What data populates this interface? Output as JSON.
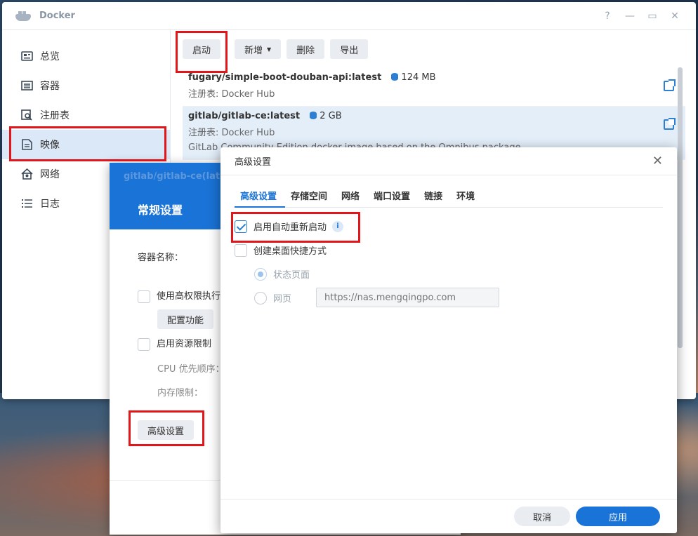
{
  "window": {
    "title": "Docker",
    "controls": {
      "help": "?",
      "minimize": "—",
      "maximize": "▭",
      "close": "✕"
    }
  },
  "sidebar": {
    "items": [
      {
        "label": "总览",
        "icon": "overview-icon"
      },
      {
        "label": "容器",
        "icon": "container-icon"
      },
      {
        "label": "注册表",
        "icon": "registry-icon"
      },
      {
        "label": "映像",
        "icon": "image-icon",
        "active": true
      },
      {
        "label": "网络",
        "icon": "network-icon"
      },
      {
        "label": "日志",
        "icon": "log-icon"
      }
    ]
  },
  "toolbar": {
    "launch": "启动",
    "add": "新增",
    "delete": "删除",
    "export": "导出"
  },
  "images": [
    {
      "name": "fugary/simple-boot-douban-api:latest",
      "size": "124 MB",
      "registry": "注册表: Docker Hub"
    },
    {
      "name": "gitlab/gitlab-ce:latest",
      "size": "2 GB",
      "registry": "注册表: Docker Hub",
      "description": "GitLab Community Edition docker image based on the Omnibus package"
    }
  ],
  "wizard": {
    "path": "gitlab/gitlab-ce(late",
    "title": "常规设置",
    "container_name_label": "容器名称：",
    "privileged_label": "使用高权限执行",
    "config_features": "配置功能",
    "resource_limit_label": "启用资源限制",
    "cpu_priority_label": "CPU 优先顺序：",
    "memory_limit_label": "内存限制：",
    "advanced_button": "高级设置"
  },
  "dialog": {
    "title": "高级设置",
    "close": "✕",
    "tabs": [
      "高级设置",
      "存储空间",
      "网络",
      "端口设置",
      "链接",
      "环境"
    ],
    "auto_restart_label": "启用自动重新启动",
    "auto_restart_checked": true,
    "info": "i",
    "desktop_shortcut_label": "创建桌面快捷方式",
    "status_page_label": "状态页面",
    "webpage_label": "网页",
    "url_placeholder": "https://nas.mengqingpo.com",
    "cancel": "取消",
    "apply": "应用"
  },
  "colors": {
    "accent": "#1a73d6",
    "highlight": "#e0161b",
    "selected_row": "#e3eef9"
  }
}
